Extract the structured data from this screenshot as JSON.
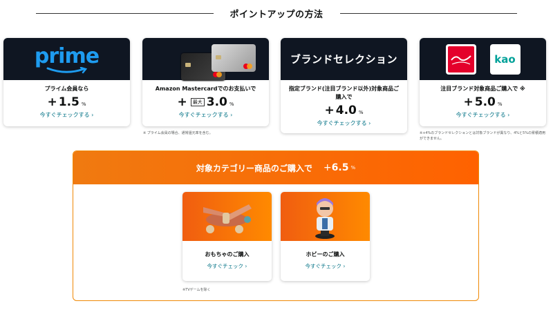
{
  "section_title": "ポイントアップの方法",
  "cards": [
    {
      "label": "プライム会員なら",
      "plus": "+",
      "rate": "1.5",
      "pct": "%",
      "link": "今すぐチェックする ›",
      "logo": "prime"
    },
    {
      "label": "Amazon Mastercardでのお支払いで",
      "plus": "+",
      "max": "最大",
      "rate": "3.0",
      "pct": "%",
      "link": "今すぐチェックする ›"
    },
    {
      "label": "指定ブランド(注目ブランド以外)対象商品ご購入で",
      "plus": "+",
      "rate": "4.0",
      "pct": "%",
      "link": "今すぐチェックする ›",
      "banner": "ブランドセレクション"
    },
    {
      "label": "注目ブランド対象商品ご購入で ※",
      "plus": "+",
      "rate": "5.0",
      "pct": "%",
      "link": "今すぐチェックする ›",
      "logo2": "kao"
    }
  ],
  "note_card2": "※ プライム会員の場合、通常還元率を含む。",
  "note_card4": "※+4%のブランドセレクションとは対象ブランドが異なり、4%と5%の累積適用ができません。",
  "promo": {
    "title": "対象カテゴリー商品のご購入で",
    "plus": "+",
    "rate": "6.5",
    "pct": "%",
    "categories": [
      {
        "label": "おもちゃのご購入",
        "link": "今すぐチェック ›"
      },
      {
        "label": "ホビーのご購入",
        "link": "今すぐチェック ›"
      }
    ],
    "note": "※TVゲームを除く"
  },
  "colors": {
    "accent": "#ff6200",
    "link": "#007185",
    "dark": "#0f1622",
    "prime_blue": "#1e9cf0"
  }
}
